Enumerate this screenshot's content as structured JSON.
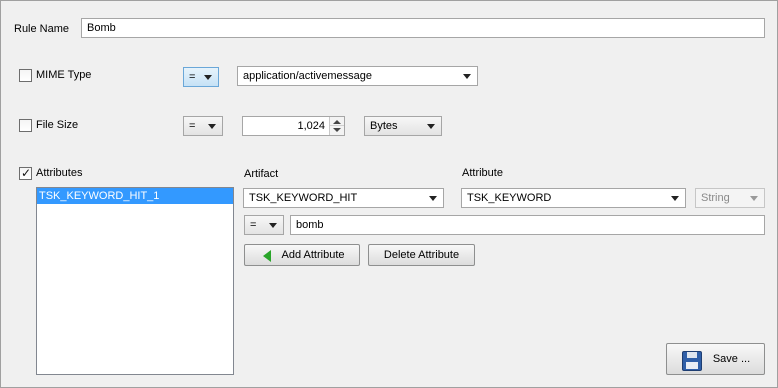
{
  "rule_name": {
    "label": "Rule Name",
    "value": "Bomb"
  },
  "mime_type": {
    "label": "MIME Type",
    "checked": false,
    "operator": "=",
    "value": "application/activemessage"
  },
  "file_size": {
    "label": "File Size",
    "checked": false,
    "operator": "=",
    "value": "1,024",
    "unit": "Bytes"
  },
  "attributes": {
    "label": "Attributes",
    "checked": true,
    "list_items": [
      "TSK_KEYWORD_HIT_1"
    ],
    "artifact_label": "Artifact",
    "artifact_value": "TSK_KEYWORD_HIT",
    "attribute_label": "Attribute",
    "attribute_value": "TSK_KEYWORD",
    "type_value": "String",
    "value_operator": "=",
    "value_text": "bomb",
    "add_button": "Add Attribute",
    "delete_button": "Delete Attribute"
  },
  "save_button": "Save ...",
  "icons": {
    "check": "checkmark-icon",
    "dropdown": "chevron-down-icon",
    "add": "green-arrow-left-icon",
    "save": "floppy-disk-icon"
  },
  "colors": {
    "selection": "#3399ff",
    "add_icon": "#2aa52a",
    "save_icon": "#2f5fa8"
  }
}
